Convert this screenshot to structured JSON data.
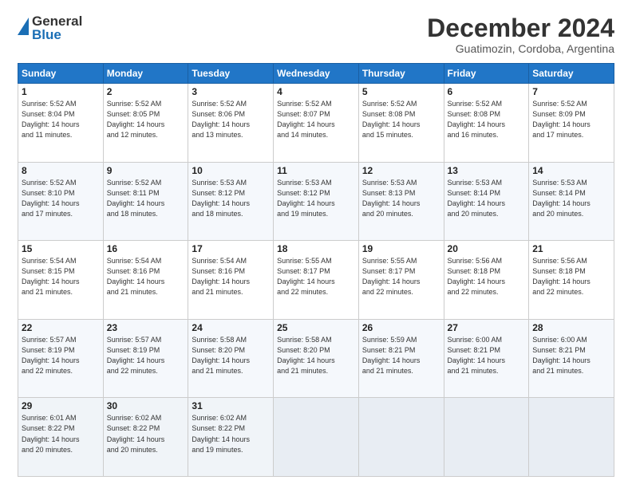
{
  "header": {
    "logo_line1": "General",
    "logo_line2": "Blue",
    "main_title": "December 2024",
    "subtitle": "Guatimozin, Cordoba, Argentina"
  },
  "calendar": {
    "days_of_week": [
      "Sunday",
      "Monday",
      "Tuesday",
      "Wednesday",
      "Thursday",
      "Friday",
      "Saturday"
    ],
    "weeks": [
      [
        {
          "day": "1",
          "info": "Sunrise: 5:52 AM\nSunset: 8:04 PM\nDaylight: 14 hours\nand 11 minutes."
        },
        {
          "day": "2",
          "info": "Sunrise: 5:52 AM\nSunset: 8:05 PM\nDaylight: 14 hours\nand 12 minutes."
        },
        {
          "day": "3",
          "info": "Sunrise: 5:52 AM\nSunset: 8:06 PM\nDaylight: 14 hours\nand 13 minutes."
        },
        {
          "day": "4",
          "info": "Sunrise: 5:52 AM\nSunset: 8:07 PM\nDaylight: 14 hours\nand 14 minutes."
        },
        {
          "day": "5",
          "info": "Sunrise: 5:52 AM\nSunset: 8:08 PM\nDaylight: 14 hours\nand 15 minutes."
        },
        {
          "day": "6",
          "info": "Sunrise: 5:52 AM\nSunset: 8:08 PM\nDaylight: 14 hours\nand 16 minutes."
        },
        {
          "day": "7",
          "info": "Sunrise: 5:52 AM\nSunset: 8:09 PM\nDaylight: 14 hours\nand 17 minutes."
        }
      ],
      [
        {
          "day": "8",
          "info": "Sunrise: 5:52 AM\nSunset: 8:10 PM\nDaylight: 14 hours\nand 17 minutes."
        },
        {
          "day": "9",
          "info": "Sunrise: 5:52 AM\nSunset: 8:11 PM\nDaylight: 14 hours\nand 18 minutes."
        },
        {
          "day": "10",
          "info": "Sunrise: 5:53 AM\nSunset: 8:12 PM\nDaylight: 14 hours\nand 18 minutes."
        },
        {
          "day": "11",
          "info": "Sunrise: 5:53 AM\nSunset: 8:12 PM\nDaylight: 14 hours\nand 19 minutes."
        },
        {
          "day": "12",
          "info": "Sunrise: 5:53 AM\nSunset: 8:13 PM\nDaylight: 14 hours\nand 20 minutes."
        },
        {
          "day": "13",
          "info": "Sunrise: 5:53 AM\nSunset: 8:14 PM\nDaylight: 14 hours\nand 20 minutes."
        },
        {
          "day": "14",
          "info": "Sunrise: 5:53 AM\nSunset: 8:14 PM\nDaylight: 14 hours\nand 20 minutes."
        }
      ],
      [
        {
          "day": "15",
          "info": "Sunrise: 5:54 AM\nSunset: 8:15 PM\nDaylight: 14 hours\nand 21 minutes."
        },
        {
          "day": "16",
          "info": "Sunrise: 5:54 AM\nSunset: 8:16 PM\nDaylight: 14 hours\nand 21 minutes."
        },
        {
          "day": "17",
          "info": "Sunrise: 5:54 AM\nSunset: 8:16 PM\nDaylight: 14 hours\nand 21 minutes."
        },
        {
          "day": "18",
          "info": "Sunrise: 5:55 AM\nSunset: 8:17 PM\nDaylight: 14 hours\nand 22 minutes."
        },
        {
          "day": "19",
          "info": "Sunrise: 5:55 AM\nSunset: 8:17 PM\nDaylight: 14 hours\nand 22 minutes."
        },
        {
          "day": "20",
          "info": "Sunrise: 5:56 AM\nSunset: 8:18 PM\nDaylight: 14 hours\nand 22 minutes."
        },
        {
          "day": "21",
          "info": "Sunrise: 5:56 AM\nSunset: 8:18 PM\nDaylight: 14 hours\nand 22 minutes."
        }
      ],
      [
        {
          "day": "22",
          "info": "Sunrise: 5:57 AM\nSunset: 8:19 PM\nDaylight: 14 hours\nand 22 minutes."
        },
        {
          "day": "23",
          "info": "Sunrise: 5:57 AM\nSunset: 8:19 PM\nDaylight: 14 hours\nand 22 minutes."
        },
        {
          "day": "24",
          "info": "Sunrise: 5:58 AM\nSunset: 8:20 PM\nDaylight: 14 hours\nand 21 minutes."
        },
        {
          "day": "25",
          "info": "Sunrise: 5:58 AM\nSunset: 8:20 PM\nDaylight: 14 hours\nand 21 minutes."
        },
        {
          "day": "26",
          "info": "Sunrise: 5:59 AM\nSunset: 8:21 PM\nDaylight: 14 hours\nand 21 minutes."
        },
        {
          "day": "27",
          "info": "Sunrise: 6:00 AM\nSunset: 8:21 PM\nDaylight: 14 hours\nand 21 minutes."
        },
        {
          "day": "28",
          "info": "Sunrise: 6:00 AM\nSunset: 8:21 PM\nDaylight: 14 hours\nand 21 minutes."
        }
      ],
      [
        {
          "day": "29",
          "info": "Sunrise: 6:01 AM\nSunset: 8:22 PM\nDaylight: 14 hours\nand 20 minutes."
        },
        {
          "day": "30",
          "info": "Sunrise: 6:02 AM\nSunset: 8:22 PM\nDaylight: 14 hours\nand 20 minutes."
        },
        {
          "day": "31",
          "info": "Sunrise: 6:02 AM\nSunset: 8:22 PM\nDaylight: 14 hours\nand 19 minutes."
        },
        {
          "day": "",
          "info": ""
        },
        {
          "day": "",
          "info": ""
        },
        {
          "day": "",
          "info": ""
        },
        {
          "day": "",
          "info": ""
        }
      ]
    ]
  }
}
